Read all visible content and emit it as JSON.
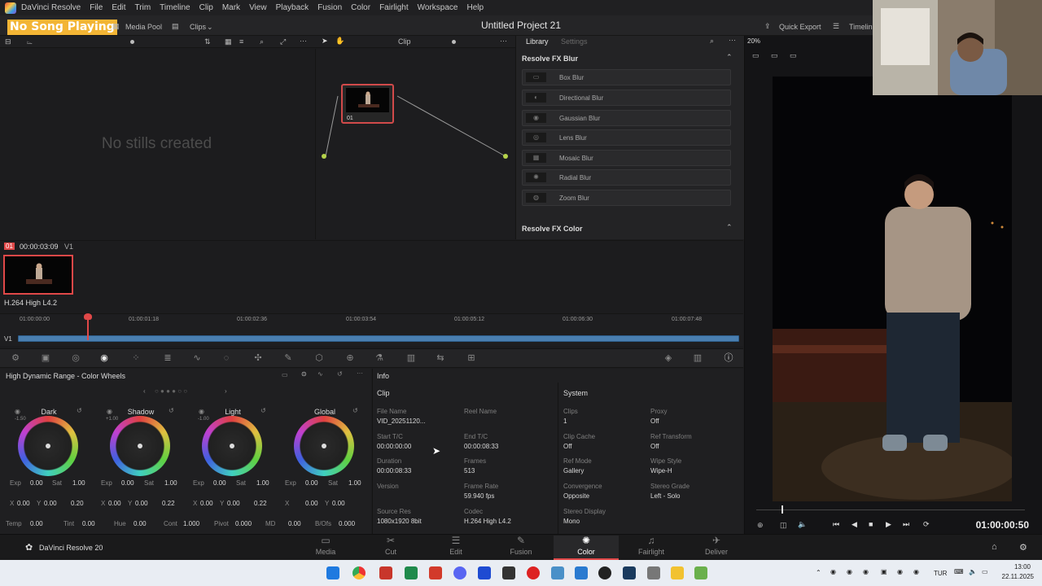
{
  "app": {
    "name": "DaVinci Resolve",
    "project_title": "Untitled Project 21",
    "menu": [
      "File",
      "Edit",
      "Trim",
      "Timeline",
      "Clip",
      "Mark",
      "View",
      "Playback",
      "Fusion",
      "Color",
      "Fairlight",
      "Workspace",
      "Help"
    ]
  },
  "overlay": {
    "now_playing": "No Song Playing"
  },
  "toolbar": {
    "media_pool": "Media Pool",
    "clips": "Clips",
    "quick_export": "Quick Export",
    "timeline": "Timeline",
    "clip_mode": "Clip",
    "zoom": "20%"
  },
  "gallery": {
    "empty_text": "No stills created"
  },
  "node": {
    "label": "01"
  },
  "library": {
    "tabs": [
      "Library",
      "Settings"
    ],
    "section_blur": "Resolve FX Blur",
    "items": [
      "Box Blur",
      "Directional Blur",
      "Gaussian Blur",
      "Lens Blur",
      "Mosaic Blur",
      "Radial Blur",
      "Zoom Blur"
    ],
    "section_color": "Resolve FX Color"
  },
  "clip": {
    "index": "01",
    "timecode": "00:00:03:09",
    "track": "V1",
    "codec": "H.264 High L4.2"
  },
  "timeline": {
    "ticks": [
      "01:00:00:00",
      "01:00:01:18",
      "01:00:02:36",
      "01:00:03:54",
      "01:00:05:12",
      "01:00:06:30",
      "01:00:07:48"
    ],
    "track": "V1"
  },
  "wheels": {
    "title": "High Dynamic Range - Color Wheels",
    "items": [
      {
        "name": "Dark",
        "range": "-1.50",
        "exp": "0.00",
        "sat": "1.00",
        "x": "0.00",
        "y": "0.20"
      },
      {
        "name": "Shadow",
        "range": "+1.00",
        "exp": "0.00",
        "sat": "1.00",
        "x": "0.00",
        "y": "0.22"
      },
      {
        "name": "Light",
        "range": "-1.00",
        "exp": "0.00",
        "sat": "1.00",
        "x": "0.00",
        "y": "0.22"
      },
      {
        "name": "Global",
        "range": "",
        "exp": "0.00",
        "sat": "1.00",
        "x": "0.00",
        "y": "0.00"
      }
    ],
    "labels": {
      "exp": "Exp",
      "sat": "Sat",
      "x": "X",
      "y": "Y"
    },
    "bottom": [
      {
        "label": "Temp",
        "value": "0.00"
      },
      {
        "label": "Tint",
        "value": "0.00"
      },
      {
        "label": "Hue",
        "value": "0.00"
      },
      {
        "label": "Cont",
        "value": "1.000"
      },
      {
        "label": "Pivot",
        "value": "0.000"
      },
      {
        "label": "MD",
        "value": "0.00"
      },
      {
        "label": "B/Ofs",
        "value": "0.000"
      }
    ]
  },
  "info": {
    "title": "Info",
    "clip_header": "Clip",
    "system_header": "System",
    "clip_fields": [
      {
        "label": "File Name",
        "value": "VID_20251120..."
      },
      {
        "label": "Reel Name",
        "value": ""
      },
      {
        "label": "Start T/C",
        "value": "00:00:00:00"
      },
      {
        "label": "End T/C",
        "value": "00:00:08:33"
      },
      {
        "label": "Duration",
        "value": "00:00:08:33"
      },
      {
        "label": "Frames",
        "value": "513"
      },
      {
        "label": "Version",
        "value": ""
      },
      {
        "label": "Frame Rate",
        "value": "59.940 fps"
      },
      {
        "label": "Source Res",
        "value": "1080x1920 8bit"
      },
      {
        "label": "Codec",
        "value": "H.264 High L4.2"
      }
    ],
    "system_fields": [
      {
        "label": "Clips",
        "value": "1"
      },
      {
        "label": "Proxy",
        "value": "Off"
      },
      {
        "label": "Clip Cache",
        "value": "Off"
      },
      {
        "label": "Ref Transform",
        "value": "Off"
      },
      {
        "label": "Ref Mode",
        "value": "Gallery"
      },
      {
        "label": "Wipe Style",
        "value": "Wipe-H"
      },
      {
        "label": "Convergence",
        "value": "Opposite"
      },
      {
        "label": "Stereo Grade",
        "value": "Left - Solo"
      },
      {
        "label": "Stereo Display",
        "value": "Mono"
      }
    ]
  },
  "viewer": {
    "timecode": "01:00:00:50"
  },
  "pages": {
    "brand": "DaVinci Resolve 20",
    "tabs": [
      "Media",
      "Cut",
      "Edit",
      "Fusion",
      "Color",
      "Fairlight",
      "Deliver"
    ],
    "active": "Color"
  },
  "taskbar": {
    "lang": "TUR",
    "time": "13:00",
    "date": "22.11.2025"
  },
  "colors": {
    "accent_red": "#e04848",
    "timeline_blue": "#4a7fb0",
    "overlay_yellow": "#f3b535"
  }
}
